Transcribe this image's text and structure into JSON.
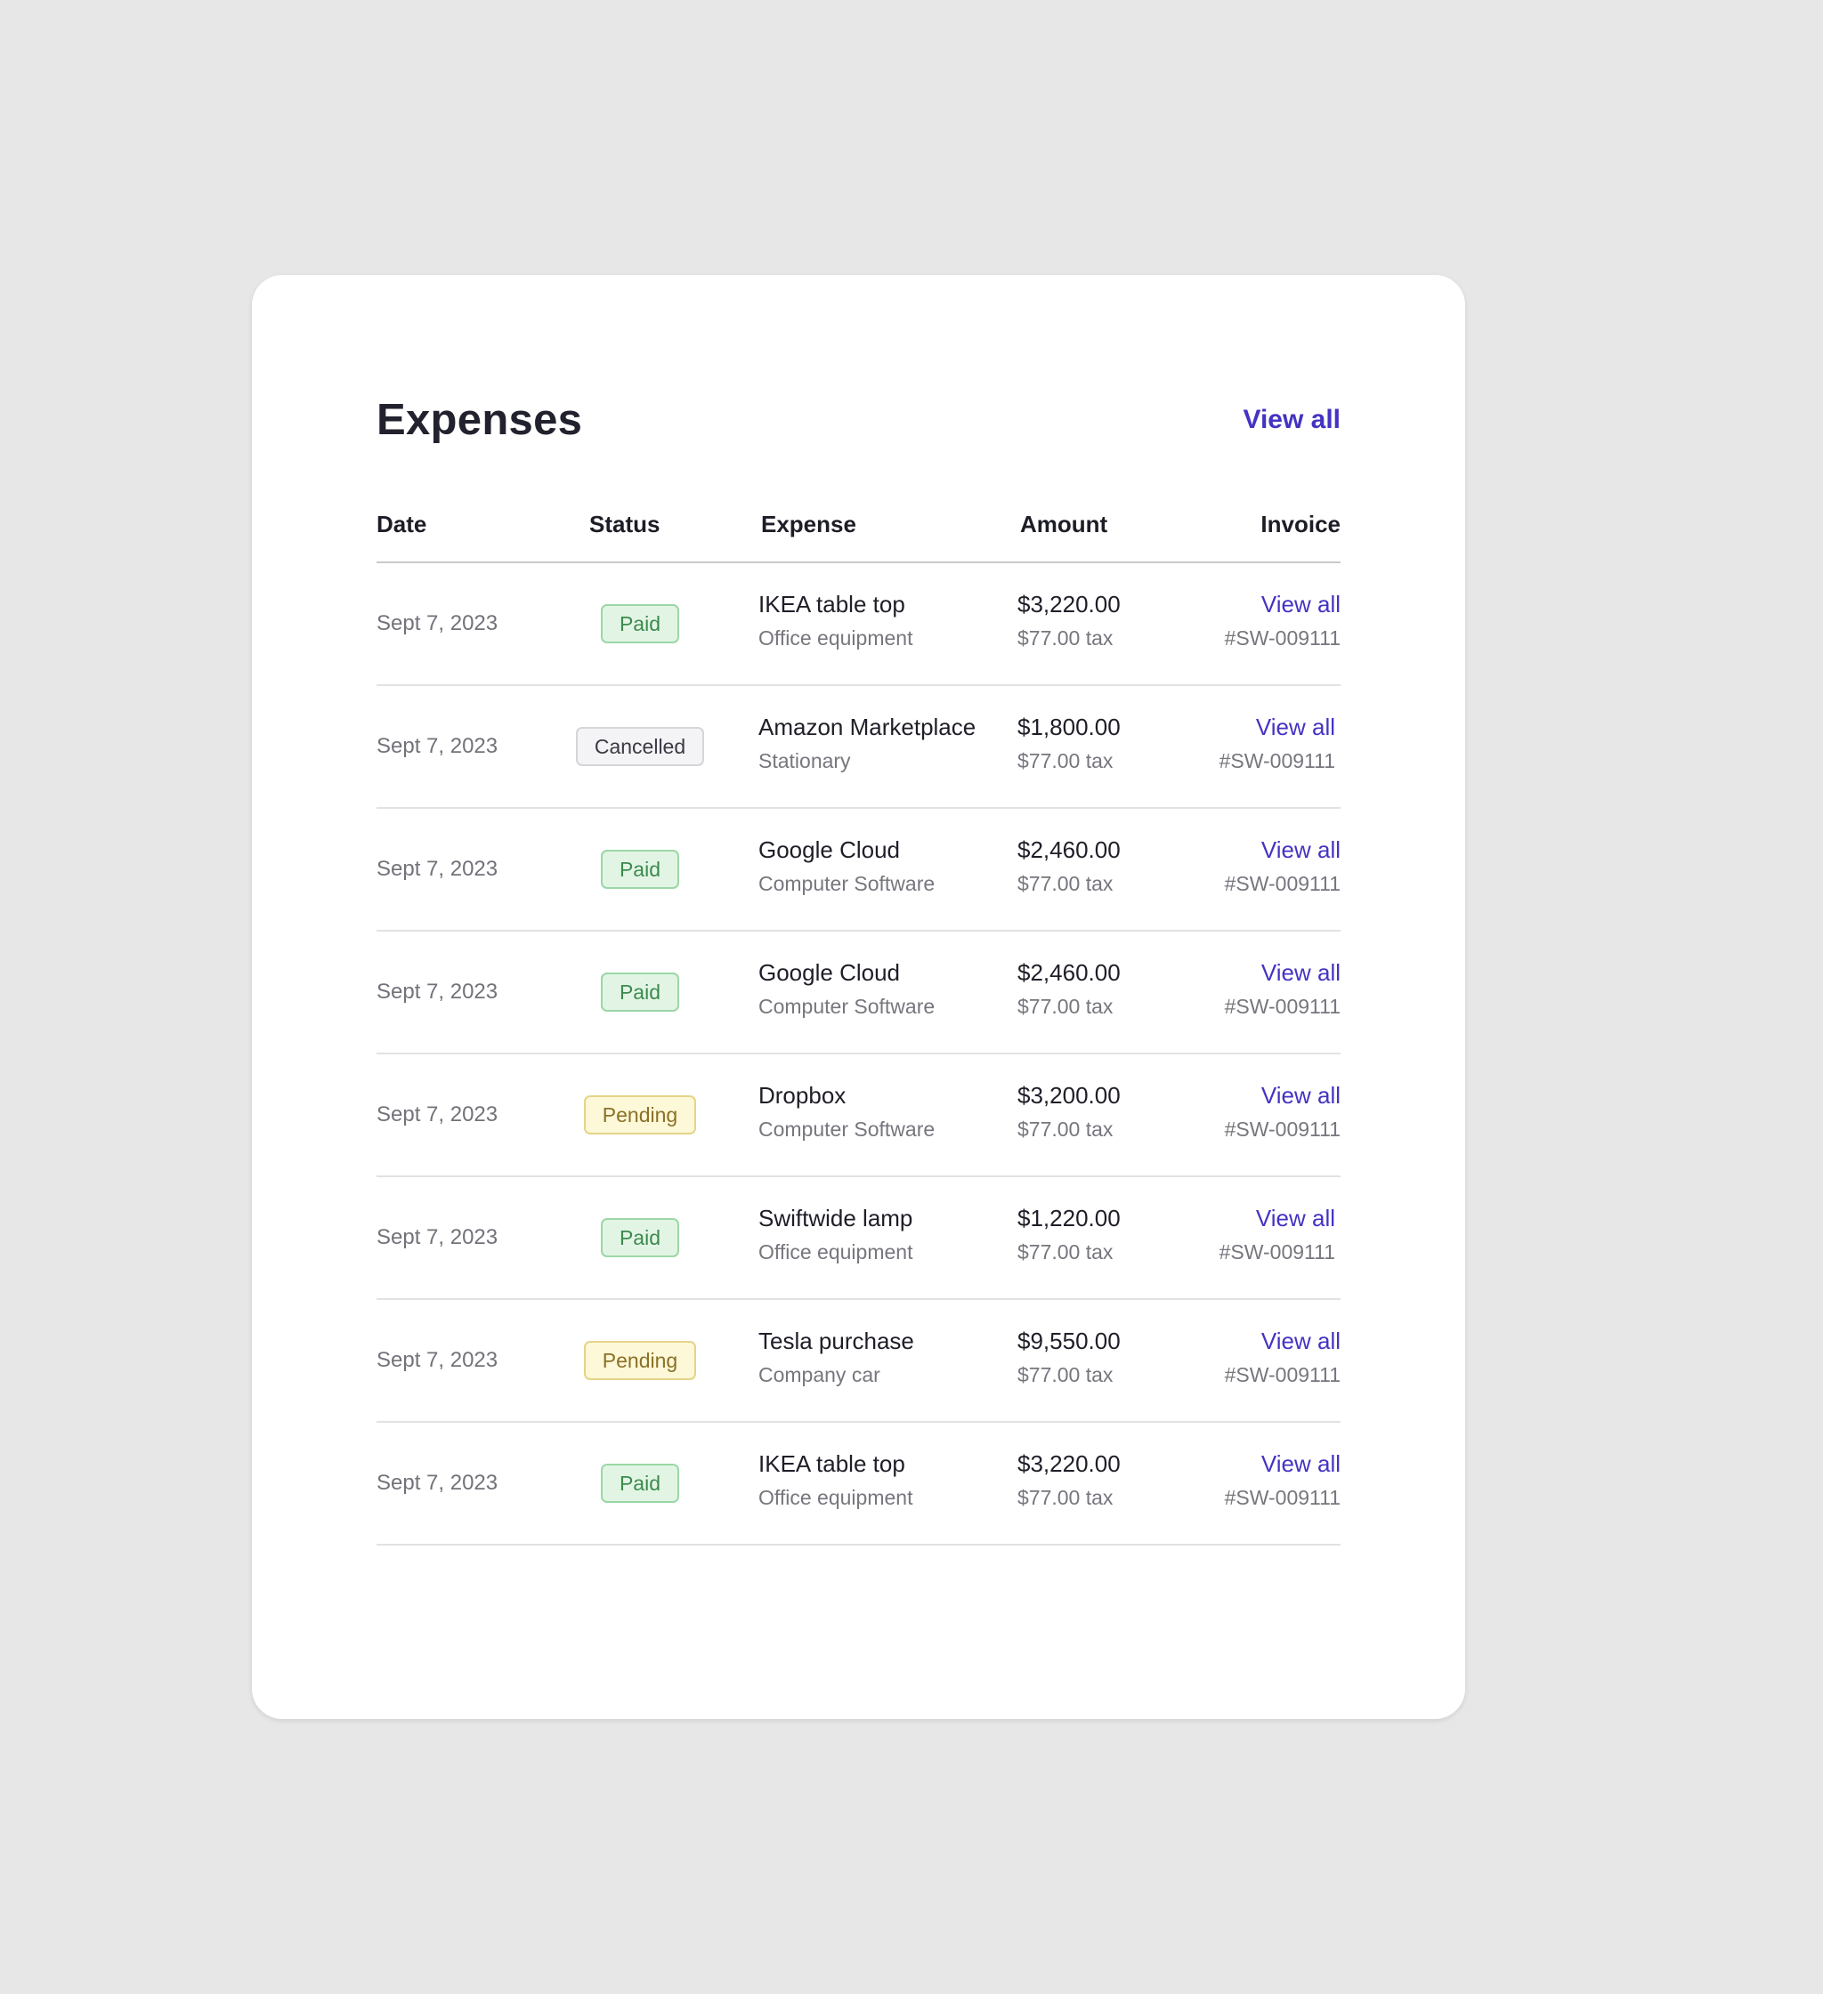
{
  "header": {
    "title": "Expenses",
    "view_all": "View all"
  },
  "columns": {
    "date": "Date",
    "status": "Status",
    "expense": "Expense",
    "amount": "Amount",
    "invoice": "Invoice"
  },
  "status_colors": {
    "paid": "#3c8a4d",
    "cancelled": "#3a3a44",
    "pending": "#8a7126",
    "link": "#4433c2"
  },
  "rows": [
    {
      "date": "Sept 7, 2023",
      "status": "Paid",
      "status_key": "paid",
      "expense": "IKEA table top",
      "category": "Office equipment",
      "amount": "$3,220.00",
      "tax": "$77.00 tax",
      "invoice_link": "View all",
      "invoice_number": "#SW-009111"
    },
    {
      "date": "Sept 7, 2023",
      "status": "Cancelled",
      "status_key": "cancelled",
      "expense": "Amazon Marketplace",
      "category": "Stationary",
      "amount": "$1,800.00",
      "tax": "$77.00 tax",
      "invoice_link": "View all",
      "invoice_number": "#SW-009111"
    },
    {
      "date": "Sept 7, 2023",
      "status": "Paid",
      "status_key": "paid",
      "expense": "Google Cloud",
      "category": "Computer Software",
      "amount": "$2,460.00",
      "tax": "$77.00 tax",
      "invoice_link": "View all",
      "invoice_number": "#SW-009111"
    },
    {
      "date": "Sept 7, 2023",
      "status": "Paid",
      "status_key": "paid",
      "expense": "Google Cloud",
      "category": "Computer Software",
      "amount": "$2,460.00",
      "tax": "$77.00 tax",
      "invoice_link": "View all",
      "invoice_number": "#SW-009111"
    },
    {
      "date": "Sept 7, 2023",
      "status": "Pending",
      "status_key": "pending",
      "expense": "Dropbox",
      "category": "Computer Software",
      "amount": "$3,200.00",
      "tax": "$77.00 tax",
      "invoice_link": "View all",
      "invoice_number": "#SW-009111"
    },
    {
      "date": "Sept 7, 2023",
      "status": "Paid",
      "status_key": "paid",
      "expense": "Swiftwide lamp",
      "category": "Office equipment",
      "amount": "$1,220.00",
      "tax": "$77.00 tax",
      "invoice_link": "View all",
      "invoice_number": "#SW-009111"
    },
    {
      "date": "Sept 7, 2023",
      "status": "Pending",
      "status_key": "pending",
      "expense": "Tesla purchase",
      "category": "Company car",
      "amount": "$9,550.00",
      "tax": "$77.00 tax",
      "invoice_link": "View all",
      "invoice_number": "#SW-009111"
    },
    {
      "date": "Sept 7, 2023",
      "status": "Paid",
      "status_key": "paid",
      "expense": "IKEA table top",
      "category": "Office equipment",
      "amount": "$3,220.00",
      "tax": "$77.00 tax",
      "invoice_link": "View all",
      "invoice_number": "#SW-009111"
    }
  ]
}
